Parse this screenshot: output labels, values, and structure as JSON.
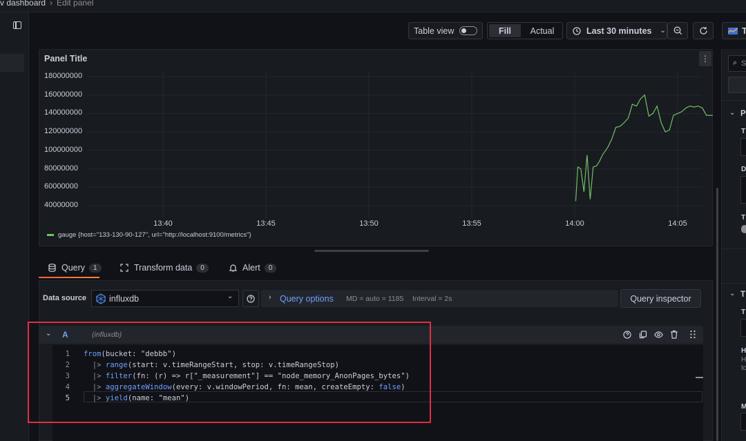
{
  "breadcrumb": {
    "parent": "v dashboard",
    "separator": "›",
    "current": "Edit panel"
  },
  "toolbar": {
    "table_view_label": "Table view",
    "fill_label": "Fill",
    "actual_label": "Actual",
    "time_range_label": "Last 30 minutes",
    "viz_picker_label": "T"
  },
  "panel": {
    "title": "Panel Title",
    "menu_icon": "kebab-icon"
  },
  "chart_data": {
    "type": "line",
    "ylim": [
      30000000,
      185000000
    ],
    "yticks": [
      "180000000",
      "160000000",
      "140000000",
      "120000000",
      "100000000",
      "80000000",
      "60000000",
      "40000000"
    ],
    "ytick_values": [
      180000000,
      160000000,
      140000000,
      120000000,
      100000000,
      80000000,
      60000000,
      40000000
    ],
    "xticks": [
      "13:40",
      "13:45",
      "13:50",
      "13:55",
      "14:00",
      "14:05"
    ],
    "xtick_minutes": [
      40,
      45,
      50,
      55,
      60,
      65
    ],
    "xlim_minutes": [
      34.2,
      70.5
    ],
    "series": [
      {
        "name": "gauge {host=\"133-130-90-127\", url=\"http://localhost:9100/metrics\"}",
        "color": "#73bf69",
        "x": [
          60.05,
          60.15,
          60.3,
          60.45,
          60.6,
          60.75,
          60.9,
          61.05,
          61.2,
          61.35,
          61.6,
          61.8,
          62.0,
          62.2,
          62.4,
          62.6,
          62.8,
          63.0,
          63.2,
          63.4,
          63.6,
          63.8,
          64.0,
          64.2,
          64.4,
          64.6,
          64.8,
          65.0,
          65.2,
          65.4,
          65.6,
          65.8,
          66.0,
          66.2,
          66.4,
          66.6,
          66.8,
          67.0,
          67.2,
          67.4,
          67.6,
          67.8,
          68.0,
          68.2,
          68.4,
          68.6,
          68.8,
          69.0,
          69.2
        ],
        "y": [
          45000000,
          82000000,
          80000000,
          55000000,
          95000000,
          47000000,
          82000000,
          83000000,
          88000000,
          95000000,
          103000000,
          112000000,
          125000000,
          126000000,
          130000000,
          135000000,
          150000000,
          148000000,
          156000000,
          160000000,
          137000000,
          140000000,
          148000000,
          130000000,
          120000000,
          122000000,
          138000000,
          140000000,
          142000000,
          146000000,
          148000000,
          147000000,
          148000000,
          146000000,
          138000000,
          138000000,
          138000000,
          138000000,
          138000000,
          138000000,
          138000000,
          138000000,
          138000000,
          138000000,
          138000000,
          138000000,
          138000000,
          138000000,
          138000000
        ]
      }
    ],
    "legend_position": "bottom-left",
    "grid": true
  },
  "tabs": [
    {
      "label": "Query",
      "count": "1",
      "icon": "database-icon"
    },
    {
      "label": "Transform data",
      "count": "0",
      "icon": "transform-icon"
    },
    {
      "label": "Alert",
      "count": "0",
      "icon": "bell-icon"
    }
  ],
  "query_bar": {
    "data_source_label": "Data source",
    "data_source_value": "influxdb",
    "query_options_label": "Query options",
    "md_info": "MD = auto = 1185",
    "interval_info": "Interval = 2s",
    "inspector_label": "Query inspector"
  },
  "query": {
    "ref_id": "A",
    "datasource_note": "(influxdb)",
    "lines": [
      {
        "n": "1",
        "text": "from(bucket: \"debbb\")"
      },
      {
        "n": "2",
        "text": "  |> range(start: v.timeRangeStart, stop: v.timeRangeStop)"
      },
      {
        "n": "3",
        "text": "  |> filter(fn: (r) => r[\"_measurement\"] == \"node_memory_AnonPages_bytes\")"
      },
      {
        "n": "4",
        "text": "  |> aggregateWindow(every: v.windowPeriod, fn: mean, createEmpty: false)"
      },
      {
        "n": "5",
        "text": "  |> yield(name: \"mean\")"
      }
    ]
  },
  "right_panel": {
    "search_placeholder": "S",
    "section1": "P",
    "section2": "T",
    "labels": [
      "T",
      "D",
      "T",
      "T",
      "H",
      "H",
      "to",
      "M"
    ]
  }
}
